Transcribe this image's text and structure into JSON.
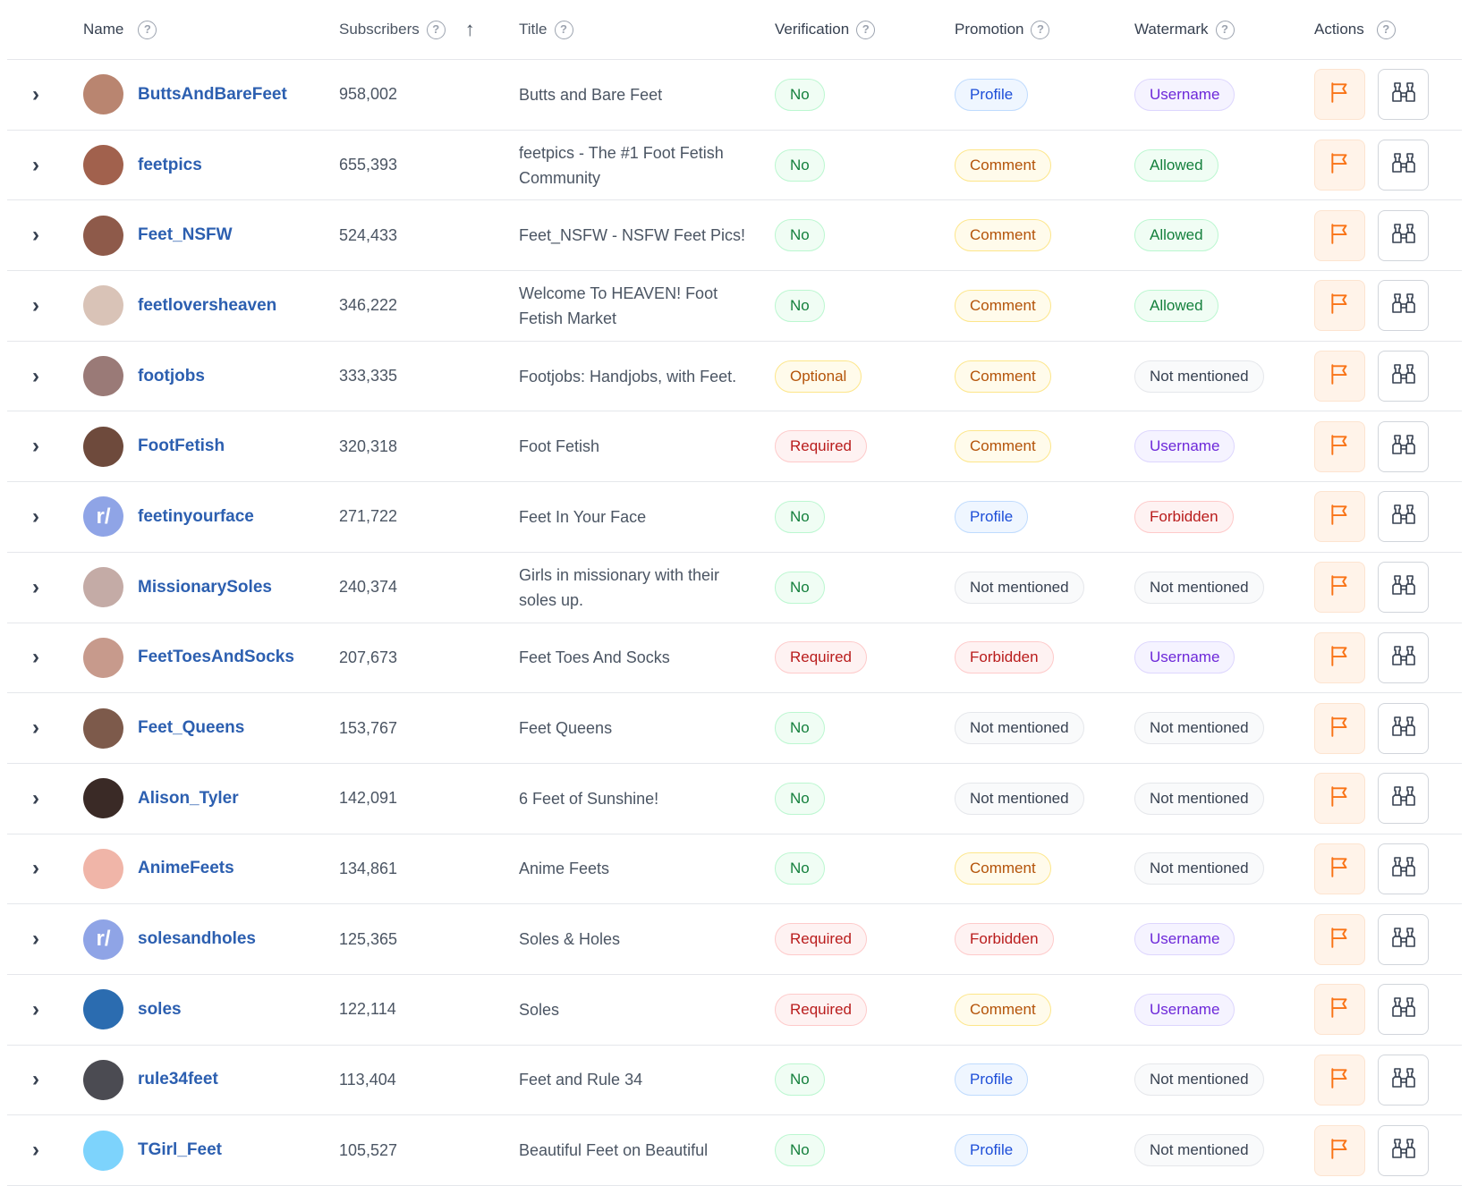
{
  "headers": {
    "name": "Name",
    "subscribers": "Subscribers",
    "title": "Title",
    "verification": "Verification",
    "promotion": "Promotion",
    "watermark": "Watermark",
    "actions": "Actions"
  },
  "help_icon": "?",
  "sort_icon": "↑",
  "expand_icon": "›",
  "colors": {
    "link": "#2c5fb0",
    "flag": "#f97316",
    "pill_green": "#15803d",
    "pill_blue": "#1d4ed8",
    "pill_purple": "#6d28d9",
    "pill_yellow": "#b45309",
    "pill_red": "#b91c1c",
    "pill_gray": "#374151"
  },
  "rows": [
    {
      "name": "ButtsAndBareFeet",
      "subscribers": "958,002",
      "title": "Butts and Bare Feet",
      "verification": "No",
      "promotion": "Profile",
      "watermark": "Username",
      "avatar_color": "#b98570",
      "avatar_text": ""
    },
    {
      "name": "feetpics",
      "subscribers": "655,393",
      "title": "feetpics - The #1 Foot Fetish Community",
      "verification": "No",
      "promotion": "Comment",
      "watermark": "Allowed",
      "avatar_color": "#a1614d",
      "avatar_text": ""
    },
    {
      "name": "Feet_NSFW",
      "subscribers": "524,433",
      "title": "Feet_NSFW - NSFW Feet Pics!",
      "verification": "No",
      "promotion": "Comment",
      "watermark": "Allowed",
      "avatar_color": "#8e5a4a",
      "avatar_text": ""
    },
    {
      "name": "feetloversheaven",
      "subscribers": "346,222",
      "title": "Welcome To HEAVEN! Foot Fetish Market",
      "verification": "No",
      "promotion": "Comment",
      "watermark": "Allowed",
      "avatar_color": "#d9c3b7",
      "avatar_text": ""
    },
    {
      "name": "footjobs",
      "subscribers": "333,335",
      "title": "Footjobs: Handjobs, with Feet.",
      "verification": "Optional",
      "promotion": "Comment",
      "watermark": "Not mentioned",
      "avatar_color": "#9a7a77",
      "avatar_text": ""
    },
    {
      "name": "FootFetish",
      "subscribers": "320,318",
      "title": "Foot Fetish",
      "verification": "Required",
      "promotion": "Comment",
      "watermark": "Username",
      "avatar_color": "#6e4a3c",
      "avatar_text": ""
    },
    {
      "name": "feetinyourface",
      "subscribers": "271,722",
      "title": "Feet In Your Face",
      "verification": "No",
      "promotion": "Profile",
      "watermark": "Forbidden",
      "avatar_color": "#8fa4e6",
      "avatar_text": "r/"
    },
    {
      "name": "MissionarySoles",
      "subscribers": "240,374",
      "title": "Girls in missionary with their soles up.",
      "verification": "No",
      "promotion": "Not mentioned",
      "watermark": "Not mentioned",
      "avatar_color": "#c4aba6",
      "avatar_text": ""
    },
    {
      "name": "FeetToesAndSocks",
      "subscribers": "207,673",
      "title": "Feet Toes And Socks",
      "verification": "Required",
      "promotion": "Forbidden",
      "watermark": "Username",
      "avatar_color": "#c79a8c",
      "avatar_text": ""
    },
    {
      "name": "Feet_Queens",
      "subscribers": "153,767",
      "title": "Feet Queens",
      "verification": "No",
      "promotion": "Not mentioned",
      "watermark": "Not mentioned",
      "avatar_color": "#7d5a4b",
      "avatar_text": ""
    },
    {
      "name": "Alison_Tyler",
      "subscribers": "142,091",
      "title": "6 Feet of Sunshine!",
      "verification": "No",
      "promotion": "Not mentioned",
      "watermark": "Not mentioned",
      "avatar_color": "#3a2a26",
      "avatar_text": ""
    },
    {
      "name": "AnimeFeets",
      "subscribers": "134,861",
      "title": "Anime Feets",
      "verification": "No",
      "promotion": "Comment",
      "watermark": "Not mentioned",
      "avatar_color": "#f0b5a8",
      "avatar_text": ""
    },
    {
      "name": "solesandholes",
      "subscribers": "125,365",
      "title": "Soles & Holes",
      "verification": "Required",
      "promotion": "Forbidden",
      "watermark": "Username",
      "avatar_color": "#8fa4e6",
      "avatar_text": "r/"
    },
    {
      "name": "soles",
      "subscribers": "122,114",
      "title": "Soles",
      "verification": "Required",
      "promotion": "Comment",
      "watermark": "Username",
      "avatar_color": "#2b6cb0",
      "avatar_text": ""
    },
    {
      "name": "rule34feet",
      "subscribers": "113,404",
      "title": "Feet and Rule 34",
      "verification": "No",
      "promotion": "Profile",
      "watermark": "Not mentioned",
      "avatar_color": "#4b4b52",
      "avatar_text": ""
    },
    {
      "name": "TGirl_Feet",
      "subscribers": "105,527",
      "title": "Beautiful Feet on Beautiful",
      "verification": "No",
      "promotion": "Profile",
      "watermark": "Not mentioned",
      "avatar_color": "#7dd3fc",
      "avatar_text": ""
    }
  ]
}
